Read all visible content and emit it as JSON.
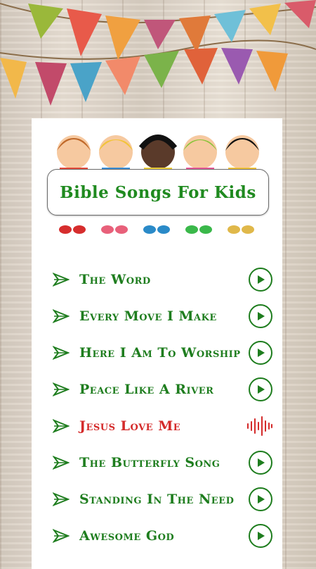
{
  "app": {
    "title": "Bible Songs For Kids"
  },
  "colors": {
    "accent_green": "#1e7d1e",
    "playing_red": "#d42a2a"
  },
  "songs": [
    {
      "title": "The Word",
      "state": "play"
    },
    {
      "title": "Every Move I Make",
      "state": "play"
    },
    {
      "title": "Here I Am To Worship",
      "state": "play"
    },
    {
      "title": "Peace Like A River",
      "state": "play"
    },
    {
      "title": "Jesus Love Me",
      "state": "playing"
    },
    {
      "title": "The Butterfly Song",
      "state": "play"
    },
    {
      "title": "Standing In The Need",
      "state": "play"
    },
    {
      "title": "Awesome God",
      "state": "play"
    }
  ],
  "icons": {
    "list_marker": "arrow-icon",
    "play": "play-icon",
    "playing": "sound-wave-icon"
  }
}
